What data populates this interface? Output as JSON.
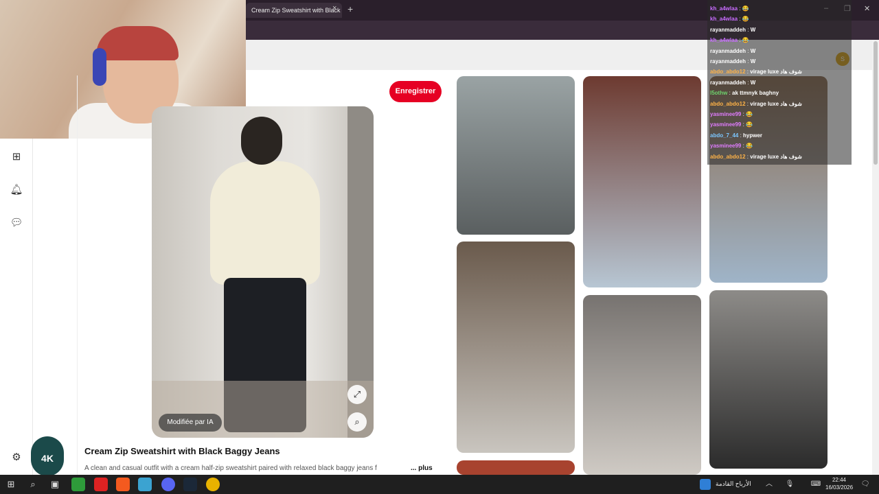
{
  "browser": {
    "tab_title": "Cream Zip Sweatshirt with Black",
    "tab_close": "×",
    "tab_new": "+",
    "window_min": "–",
    "window_max": "❐",
    "window_close": "✕"
  },
  "pin": {
    "save_label": "Enregistrer",
    "ai_badge": "Modifiée par IA",
    "title": "Cream Zip Sweatshirt with Black Baggy Jeans",
    "description": "A clean and casual outfit with a cream half-zip sweatshirt paired with relaxed black baggy jeans f",
    "more_label": "... plus"
  },
  "logo": {
    "text": "4K"
  },
  "grid": [
    {
      "color_top": "#9aa3a4",
      "color_bottom": "#5a5f60"
    },
    {
      "color_top": "#6a5a4c",
      "color_bottom": "#c9c5bf"
    },
    {
      "color_top": "#8c6d52",
      "color_bottom": "#9fb4c8"
    },
    {
      "color_top": "#6d3a30",
      "color_bottom": "#b7c6d3"
    },
    {
      "color_top": "#777370",
      "color_bottom": "#cfcac4"
    },
    {
      "color_top": "#8d8b88",
      "color_bottom": "#2b2b2b"
    }
  ],
  "chat": [
    {
      "user": "kh_a4wlaa",
      "msg": "😂",
      "color": "#c86cff"
    },
    {
      "user": "kh_a4wlaa",
      "msg": "😂",
      "color": "#c86cff"
    },
    {
      "user": "rayanmaddeh",
      "msg": "W",
      "color": "#ffffff"
    },
    {
      "user": "kh_a4wlaa",
      "msg": "😂",
      "color": "#c86cff"
    },
    {
      "user": "rayanmaddeh",
      "msg": "W",
      "color": "#ffffff"
    },
    {
      "user": "rayanmaddeh",
      "msg": "W",
      "color": "#ffffff"
    },
    {
      "user": "abdo_abdo12",
      "msg": "virage luxe شوف هاد",
      "color": "#ffb347"
    },
    {
      "user": "rayanmaddeh",
      "msg": "W",
      "color": "#ffffff"
    },
    {
      "user": "l5othw",
      "msg": "ak ttmnyk baghny",
      "color": "#6ed36e"
    },
    {
      "user": "abdo_abdo12",
      "msg": "virage luxe شوف هاد",
      "color": "#ffb347"
    },
    {
      "user": "yasminee99",
      "msg": "😂",
      "color": "#e07cff"
    },
    {
      "user": "yasminee99",
      "msg": "😂",
      "color": "#e07cff"
    },
    {
      "user": "abdo_7_44",
      "msg": "hypwer",
      "color": "#7cc7ff"
    },
    {
      "user": "yasminee99",
      "msg": "😂",
      "color": "#e07cff"
    },
    {
      "user": "abdo_abdo12",
      "msg": "virage luxe شوف هاد",
      "color": "#ffb347"
    }
  ],
  "taskbar": {
    "weather_text": "الأرباح القادمة",
    "time": "22:44",
    "date": "16/03/2026"
  },
  "colors": {
    "accent": "#e60023",
    "tabbar": "#2a1f2b",
    "taskbar": "#1f1f1f"
  }
}
